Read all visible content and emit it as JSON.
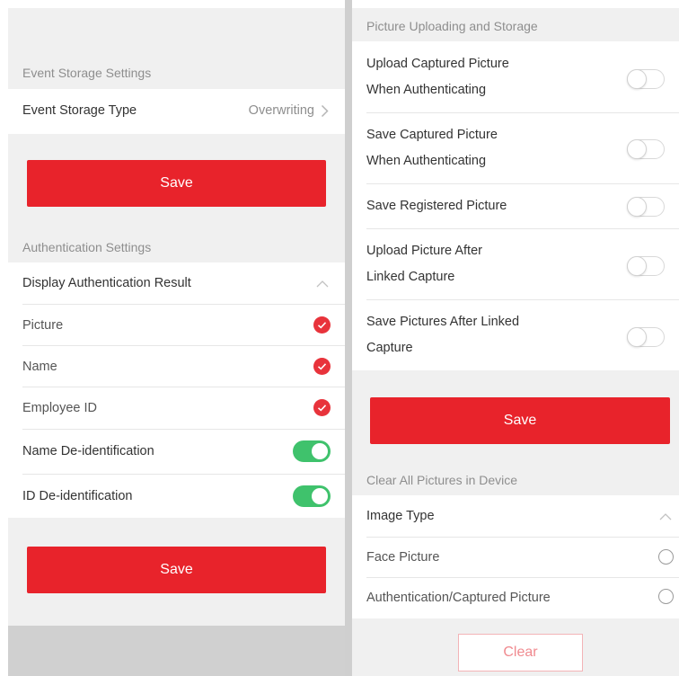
{
  "left": {
    "event_storage": {
      "header": "Event Storage Settings",
      "type_label": "Event Storage Type",
      "type_value": "Overwriting",
      "save_label": "Save"
    },
    "authentication": {
      "header": "Authentication Settings",
      "display_result_label": "Display Authentication Result",
      "items": [
        {
          "label": "Picture",
          "checked": true
        },
        {
          "label": "Name",
          "checked": true
        },
        {
          "label": "Employee ID",
          "checked": true
        }
      ],
      "name_deid_label": "Name De-identification",
      "name_deid_on": true,
      "id_deid_label": "ID De-identification",
      "id_deid_on": true,
      "save_label": "Save"
    }
  },
  "right": {
    "upload_storage": {
      "header": "Picture Uploading and Storage",
      "items": [
        {
          "line1": "Upload Captured Picture",
          "line2": "When Authenticating",
          "on": false
        },
        {
          "line1": "Save Captured Picture",
          "line2": "When Authenticating",
          "on": false
        },
        {
          "line1": "Save Registered Picture",
          "on": false
        },
        {
          "line1": "Upload Picture After",
          "line2": "Linked Capture",
          "on": false
        },
        {
          "line1": "Save Pictures After Linked",
          "line2": "Capture",
          "on": false
        }
      ],
      "save_label": "Save"
    },
    "clear_pictures": {
      "header": "Clear All Pictures in Device",
      "image_type_label": "Image Type",
      "options": [
        {
          "label": "Face Picture",
          "selected": false
        },
        {
          "label": "Authentication/Captured Picture",
          "selected": false
        }
      ],
      "clear_label": "Clear"
    }
  },
  "colors": {
    "accent_red": "#e8232b",
    "toggle_green": "#3fc26c",
    "section_bg": "#f0f0f0"
  },
  "icons": {
    "chevron_right": "chevron-right-icon",
    "chevron_up": "chevron-up-icon",
    "check": "check-circle-icon"
  }
}
